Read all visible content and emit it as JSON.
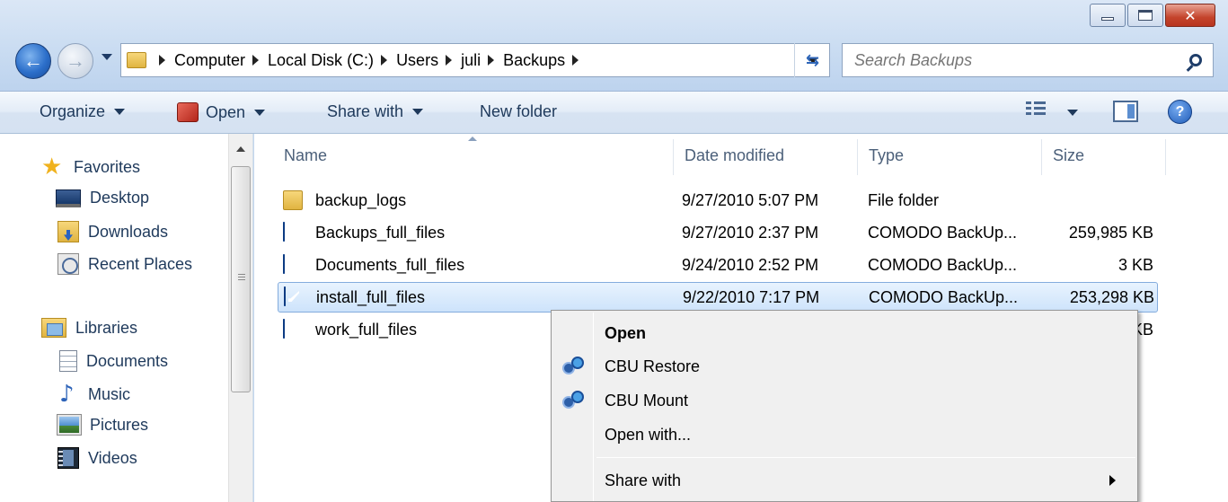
{
  "window": {
    "controls": {
      "minimize_icon": "minimize-icon",
      "maximize_icon": "maximize-icon",
      "close_icon": "close-icon",
      "close_glyph": "✕"
    }
  },
  "nav": {
    "back_glyph": "←",
    "forward_glyph": "→",
    "refresh_glyph": "⇆"
  },
  "address": {
    "crumbs": [
      "Computer",
      "Local Disk (C:)",
      "Users",
      "juli",
      "Backups"
    ]
  },
  "search": {
    "placeholder": "Search Backups",
    "value": ""
  },
  "toolbar": {
    "organize": "Organize",
    "open": "Open",
    "share_with": "Share with",
    "new_folder": "New folder",
    "help_glyph": "?"
  },
  "sidebar": {
    "favorites": {
      "label": "Favorites",
      "icon": "star-icon",
      "glyph": "★"
    },
    "favorite_items": [
      {
        "label": "Desktop",
        "icon": "desktop-icon"
      },
      {
        "label": "Downloads",
        "icon": "downloads-icon"
      },
      {
        "label": "Recent Places",
        "icon": "recent-places-icon"
      }
    ],
    "libraries": {
      "label": "Libraries",
      "icon": "libraries-icon"
    },
    "library_items": [
      {
        "label": "Documents",
        "icon": "documents-icon"
      },
      {
        "label": "Music",
        "icon": "music-icon",
        "glyph": "♪"
      },
      {
        "label": "Pictures",
        "icon": "pictures-icon"
      },
      {
        "label": "Videos",
        "icon": "videos-icon"
      }
    ]
  },
  "columns": {
    "name": "Name",
    "date": "Date modified",
    "type": "Type",
    "size": "Size"
  },
  "files": [
    {
      "name": "backup_logs",
      "date": "9/27/2010 5:07 PM",
      "type": "File folder",
      "size": "",
      "icon": "folder-icon"
    },
    {
      "name": "Backups_full_files",
      "date": "9/27/2010 2:37 PM",
      "type": "COMODO BackUp...",
      "size": "259,985 KB",
      "icon": "cbu-file-icon"
    },
    {
      "name": "Documents_full_files",
      "date": "9/24/2010 2:52 PM",
      "type": "COMODO BackUp...",
      "size": "3 KB",
      "icon": "cbu-file-icon"
    },
    {
      "name": "install_full_files",
      "date": "9/22/2010 7:17 PM",
      "type": "COMODO BackUp...",
      "size": "253,298 KB",
      "icon": "cbu-file-icon",
      "selected": true
    },
    {
      "name": "work_full_files",
      "date": "",
      "type": "",
      "size": "KB",
      "icon": "cbu-file-icon"
    }
  ],
  "context_menu": {
    "open": "Open",
    "cbu_restore": "CBU Restore",
    "cbu_mount": "CBU Mount",
    "open_with": "Open with...",
    "share_with": "Share with"
  },
  "colors": {
    "accent": "#1e395b",
    "selection": "#cde3fb",
    "selection_border": "#84acdd"
  }
}
